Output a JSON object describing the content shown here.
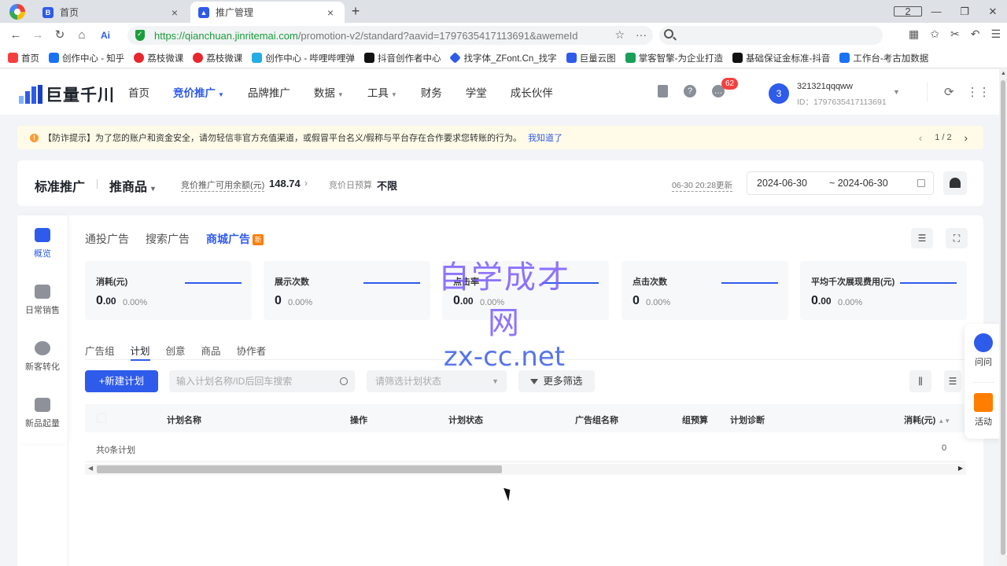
{
  "browser": {
    "tabs": [
      {
        "title": "首页",
        "favicon_color": "#2f5bea",
        "favicon_glyph": "B"
      },
      {
        "title": "推广管理",
        "favicon_color": "#2f5bea",
        "favicon_glyph": "▲"
      }
    ],
    "new_tab": "+",
    "window_badge": "2",
    "url_host": "https://qianchuan.jinritemai.com",
    "url_path": "/promotion-v2/standard?aavid=1797635417113691&awemeId",
    "bookmarks": [
      {
        "label": "首页",
        "color": "#f53f3f"
      },
      {
        "label": "创作中心 - 知乎",
        "color": "#1772f6"
      },
      {
        "label": "荔枝微课",
        "color": "#e8262d"
      },
      {
        "label": "荔枝微课",
        "color": "#e8262d"
      },
      {
        "label": "创作中心 - 哔哩哔哩弹",
        "color": "#23ade5"
      },
      {
        "label": "抖音创作者中心",
        "color": "#111111"
      },
      {
        "label": "找字体_ZFont.Cn_找字",
        "color": "#2f5bea"
      },
      {
        "label": "巨量云图",
        "color": "#2f5bea"
      },
      {
        "label": "掌客智擎-为企业打造",
        "color": "#18a058"
      },
      {
        "label": "基础保证金标准-抖音",
        "color": "#111111"
      },
      {
        "label": "工作台-考古加数据",
        "color": "#1772f6"
      }
    ]
  },
  "header": {
    "logo_text": "巨量千川",
    "nav": [
      {
        "label": "首页",
        "active": false,
        "caret": false
      },
      {
        "label": "竞价推广",
        "active": true,
        "caret": true
      },
      {
        "label": "品牌推广",
        "active": false,
        "caret": false
      },
      {
        "label": "数据",
        "active": false,
        "caret": true
      },
      {
        "label": "工具",
        "active": false,
        "caret": true
      },
      {
        "label": "财务",
        "active": false,
        "caret": false
      },
      {
        "label": "学堂",
        "active": false,
        "caret": false
      },
      {
        "label": "成长伙伴",
        "active": false,
        "caret": false
      }
    ],
    "message_count": "62",
    "avatar_label": "3",
    "user_name": "321321qqqww",
    "user_id": "ID：1797635417113691"
  },
  "notice": {
    "text": "【防诈提示】为了您的账户和资金安全，请勿轻信非官方充值渠道，或假冒平台名义/假称与平台存在合作要求您转账的行为。",
    "link": "我知道了",
    "page": "1",
    "page_sep": "/",
    "total": "2"
  },
  "title_row": {
    "title": "标准推广",
    "product": "推商品",
    "balance_label": "竞价推广可用余额(元)",
    "balance_value": "148.74",
    "budget_label": "竞价日预算",
    "budget_value": "不限",
    "update_time": "06-30 20:28更新",
    "date_start": "2024-06-30",
    "date_end": "~ 2024-06-30"
  },
  "side_nav": [
    {
      "label": "概览",
      "active": true
    },
    {
      "label": "日常销售",
      "active": false
    },
    {
      "label": "新客转化",
      "active": false
    },
    {
      "label": "新品起量",
      "active": false
    }
  ],
  "channel_tabs": [
    {
      "label": "通投广告",
      "active": false
    },
    {
      "label": "搜索广告",
      "active": false
    },
    {
      "label": "商城广告",
      "active": true,
      "badge": "新"
    }
  ],
  "metrics": [
    {
      "label": "消耗(元)",
      "value": "0",
      "decimals": ".00",
      "pct": "0.00%"
    },
    {
      "label": "展示次数",
      "value": "0",
      "decimals": "",
      "pct": "0.00%"
    },
    {
      "label": "点击率",
      "value": "0",
      "decimals": ".00",
      "pct": "0.00%"
    },
    {
      "label": "点击次数",
      "value": "0",
      "decimals": "",
      "pct": "0.00%"
    },
    {
      "label": "平均千次展现费用(元)",
      "value": "0",
      "decimals": ".00",
      "pct": "0.00%"
    }
  ],
  "sub_tabs": [
    {
      "label": "广告组",
      "active": false
    },
    {
      "label": "计划",
      "active": true
    },
    {
      "label": "创意",
      "active": false
    },
    {
      "label": "商品",
      "active": false
    },
    {
      "label": "协作者",
      "active": false
    }
  ],
  "toolbar": {
    "new_plan": "+新建计划",
    "search_placeholder": "输入计划名称/ID后回车搜索",
    "status_placeholder": "请筛选计划状态",
    "more_filter": "更多筛选"
  },
  "table": {
    "columns": [
      "计划名称",
      "操作",
      "计划状态",
      "广告组名称",
      "组预算",
      "计划诊断",
      "消耗(元)"
    ],
    "count_text": "共0条计划",
    "total_value": "0"
  },
  "float_panel": [
    {
      "label": "问问",
      "color": "#2f5bea"
    },
    {
      "label": "活动",
      "color": "#ff7d00"
    }
  ],
  "watermark": {
    "cn": "自学成才网",
    "en": "zx-cc.net"
  }
}
